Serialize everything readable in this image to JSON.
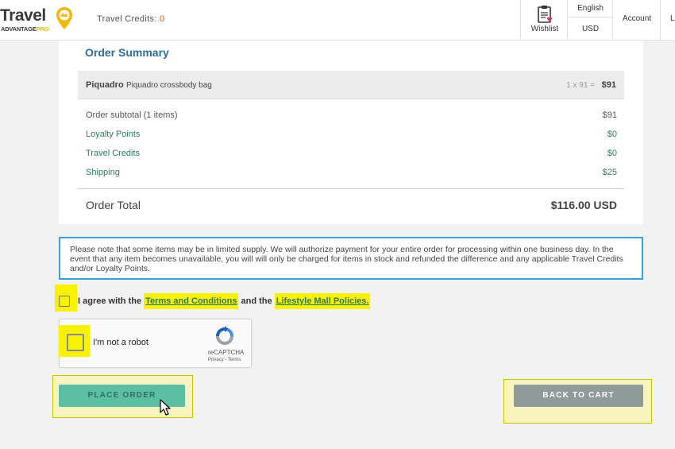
{
  "header": {
    "logo_word": "Travel",
    "logo_sub": "ADVANTAGE",
    "logo_pro": "PRO",
    "credits_label": "Travel Credits:",
    "credits_value": "0",
    "wishlist_label": "Wishlist",
    "language": "English",
    "currency": "USD",
    "account_label": "Account",
    "cutoff_label": "Lo"
  },
  "summary": {
    "title": "Order Summary",
    "item": {
      "brand": "Piquadro",
      "description": "Piquadro crossbody bag",
      "qty_calc": "1 x 91 =",
      "price": "$91"
    },
    "rows": [
      {
        "label": "Order subtotal (1 items)",
        "value": "$91"
      },
      {
        "label": "Loyalty Points",
        "value": "$0"
      },
      {
        "label": "Travel Credits",
        "value": "$0"
      },
      {
        "label": "Shipping",
        "value": "$25"
      }
    ],
    "total_label": "Order Total",
    "total_value": "$116.00 USD"
  },
  "notice": {
    "text": "Please note that some items may be in limited supply. We will authorize payment for your entire order for processing within one business day. In the event that any item becomes unavailable, you will will only be charged for items in stock and refunded the difference and any applicable Travel Credits and/or Loyalty Points."
  },
  "agree": {
    "prefix": "I agree with the",
    "terms_link": "Terms and Conditions",
    "middle": "and the",
    "policies_link": "Lifestyle Mall Policies",
    "suffix": "."
  },
  "captcha": {
    "label": "I'm not a robot",
    "brand": "reCAPTCHA",
    "links": "Privacy - Terms"
  },
  "buttons": {
    "place_order": "PLACE ORDER",
    "back_to_cart": "BACK TO CART"
  },
  "colors": {
    "accent_blue": "#2f6c97",
    "accent_green": "#2b7a68",
    "highlight": "#f8f200",
    "place_button": "#5cbfa5",
    "back_button": "#8f9b98",
    "credits_value": "#e5531a"
  },
  "icons": [
    "location-pin-icon",
    "wishlist-clipboard-icon",
    "recaptcha-icon",
    "mouse-cursor-icon"
  ]
}
